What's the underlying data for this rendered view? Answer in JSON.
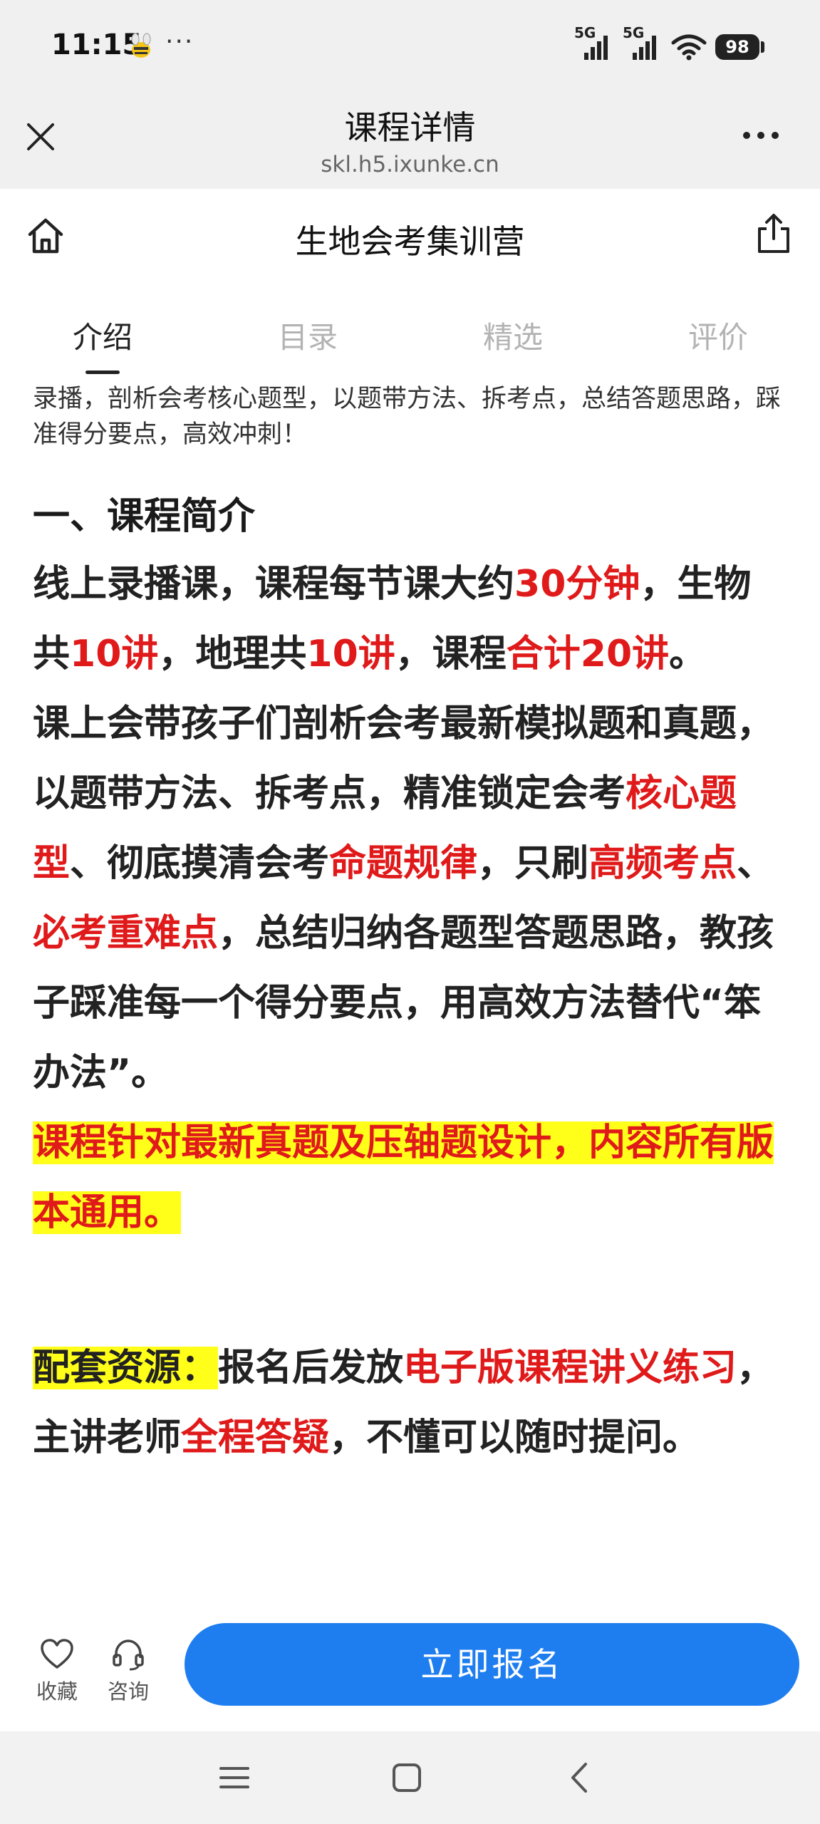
{
  "status_bar": {
    "time": "11:15",
    "dots": "···",
    "signal_1_label": "5G",
    "signal_2_label": "5G",
    "battery": "98"
  },
  "browser": {
    "title": "课程详情",
    "url": "skl.h5.ixunke.cn"
  },
  "page": {
    "title": "生地会考集训营"
  },
  "tabs": [
    {
      "label": "介绍",
      "active": true
    },
    {
      "label": "目录",
      "active": false
    },
    {
      "label": "精选",
      "active": false
    },
    {
      "label": "评价",
      "active": false
    }
  ],
  "content": {
    "intro": "录播，剖析会考核心题型，以题带方法、拆考点，总结答题思路，踩准得分要点，高效冲刺！",
    "heading": "一、课程简介",
    "p1": {
      "s1": "线上录播课，课程每节课大约",
      "r1": "30分钟",
      "s2": "，生物共",
      "r2": "10讲",
      "s3": "，地理共",
      "r3": "10讲",
      "s4": "，课程",
      "r4": "合计20讲",
      "s5": "。"
    },
    "p2": {
      "s1": "课上会带孩子们剖析会考最新模拟题和真题，以题带方法、拆考点，精准锁定会考",
      "r1": "核心题型",
      "s2": "、彻底摸清会考",
      "r2": "命题规律",
      "s3": "，只刷",
      "r3": "高频考点",
      "s4": "、",
      "r4": "必考重难点",
      "s5": "，总结归纳各题型答题思路，教孩子踩准每一个得分要点，用高效方法替代“笨办法”。"
    },
    "p3": "课程针对最新真题及压轴题设计，内容所有版本通用。",
    "p4": {
      "label": "配套资源：",
      "s1": "报名后发放",
      "r1": "电子版课程讲义练习",
      "s2": "，主讲老师",
      "r2": "全程答疑",
      "s3": "，不懂可以随时提问。"
    }
  },
  "action_bar": {
    "favorite": "收藏",
    "consult": "咨询",
    "signup": "立即报名"
  },
  "colors": {
    "accent": "#1e7ef0",
    "highlight_red": "#e01a1a",
    "highlight_yellow": "#ffff1a"
  }
}
